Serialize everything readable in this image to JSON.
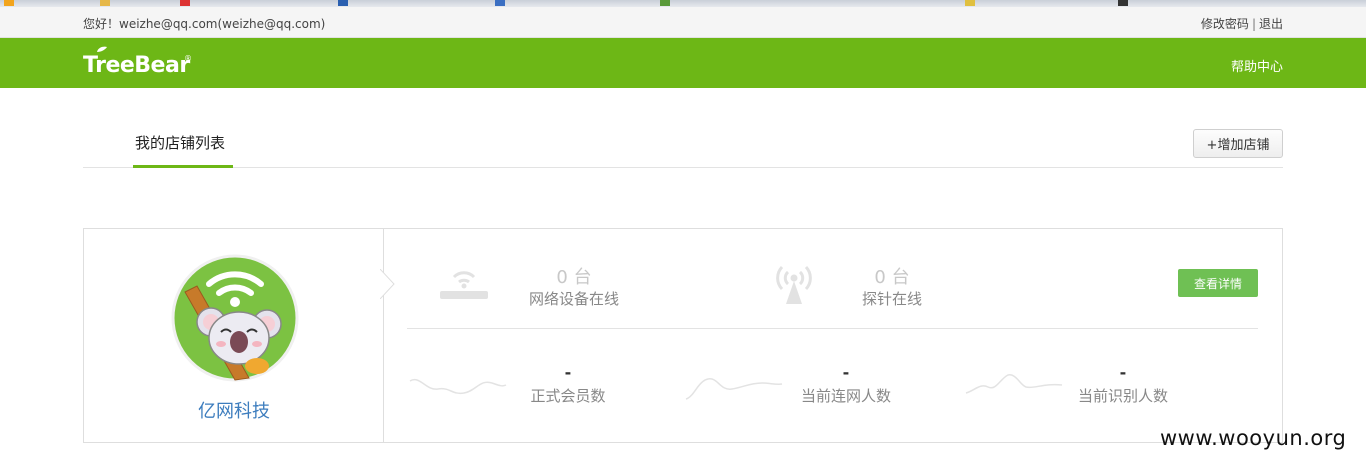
{
  "topbar": {
    "greeting": "您好！weizhe@qq.com(weizhe@qq.com)",
    "change_password": "修改密码",
    "separator": "|",
    "logout": "退出"
  },
  "header": {
    "logo_text": "TreeBear",
    "logo_mark": "®",
    "help": "帮助中心",
    "brand_color": "#6db716"
  },
  "tabs": {
    "active_label": "我的店铺列表",
    "add_store_label": "+增加店铺"
  },
  "store": {
    "name": "亿网科技",
    "avatar_icon": "koala-wifi-avatar",
    "stats_top": [
      {
        "value": "0 台",
        "label": "网络设备在线",
        "icon": "router-icon"
      },
      {
        "value": "0 台",
        "label": "探针在线",
        "icon": "probe-tower-icon"
      }
    ],
    "detail_button": "查看详情",
    "stats_bottom": [
      {
        "value": "-",
        "label": "正式会员数"
      },
      {
        "value": "-",
        "label": "当前连网人数"
      },
      {
        "value": "-",
        "label": "当前识别人数"
      }
    ]
  },
  "watermark": "www.wooyun.org"
}
